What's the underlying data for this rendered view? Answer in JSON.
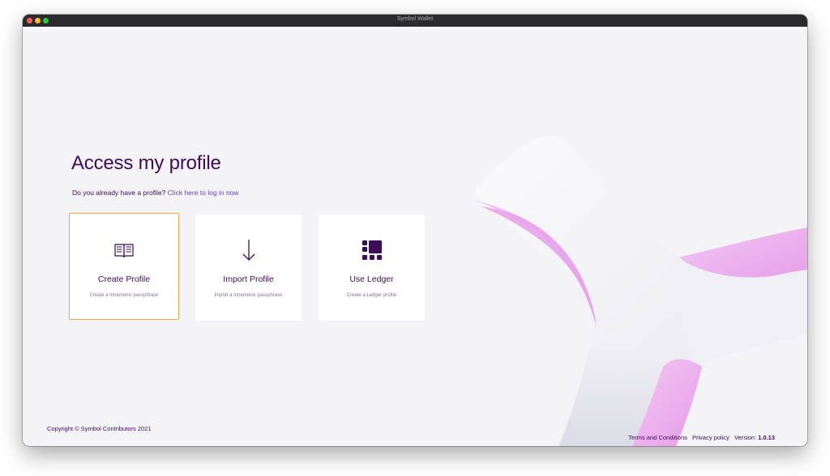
{
  "window": {
    "title": "Symbol Wallet"
  },
  "main": {
    "heading": "Access my profile",
    "prompt": "Do you already have a profile?",
    "login_link": "Click here to log in now"
  },
  "cards": [
    {
      "title": "Create Profile",
      "description": "Create a mnemonic passphrase",
      "icon": "open-book-icon"
    },
    {
      "title": "Import Profile",
      "description": "Import a mnemonic passphrase",
      "icon": "arrow-down-icon"
    },
    {
      "title": "Use Ledger",
      "description": "Create a Ledger profile",
      "icon": "ledger-device-icon"
    }
  ],
  "footer": {
    "copyright": "Copyright © Symbol Contributors 2021",
    "terms": "Terms and Conditions",
    "privacy": "Privacy policy",
    "version_label": "Version:",
    "version_value": "1.0.13"
  },
  "colors": {
    "primary": "#3f0a57",
    "link": "#6b3fd4",
    "selected_border": "#f4a44c",
    "background": "#f3f3f8",
    "accent_pink": "#e9a6ee"
  }
}
